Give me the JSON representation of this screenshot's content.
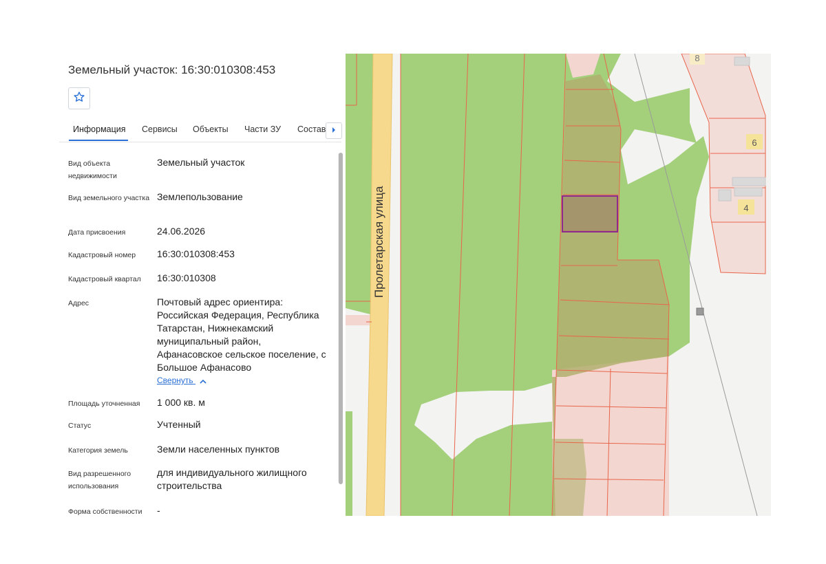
{
  "panel": {
    "title": "Земельный участок: 16:30:010308:453",
    "favorite_icon": "star-icon",
    "tabs": [
      "Информация",
      "Сервисы",
      "Объекты",
      "Части ЗУ",
      "Состав"
    ],
    "active_tab": "Информация",
    "next_icon": "chevron-right-icon",
    "fields": [
      {
        "label": "Вид объекта недвижимости",
        "value": "Земельный участок"
      },
      {
        "label": "Вид земельного участка",
        "value": "Землепользование"
      },
      {
        "label": "Дата присвоения",
        "value": "24.06.2026"
      },
      {
        "label": "Кадастровый номер",
        "value": "16:30:010308:453"
      },
      {
        "label": "Кадастровый квартал",
        "value": "16:30:010308"
      },
      {
        "label": "Адрес",
        "value": "Почтовый адрес ориентира: Российская Федерация, Республика Татарстан, Нижнекамский муниципальный район, Афанасовское сельское поселение, с Большое Афанасово"
      },
      {
        "label": "Площадь уточненная",
        "value": "1 000 кв. м"
      },
      {
        "label": "Статус",
        "value": "Учтенный"
      },
      {
        "label": "Категория земель",
        "value": "Земли населенных пунктов"
      },
      {
        "label": "Вид разрешенного использования",
        "value": "для индивидуального жилищного строительства"
      },
      {
        "label": "Форма собственности",
        "value": "-"
      }
    ],
    "collapse_label": "Свернуть",
    "collapse_icon": "chevron-up-icon"
  },
  "map": {
    "street_label": "Пролетарская улица",
    "house_numbers": [
      "8",
      "6",
      "4"
    ],
    "colors": {
      "background": "#f3f3f2",
      "green": "#a4d07c",
      "pink": "#f3d6d0",
      "parcel_fill": "#b2b070",
      "parcel_line": "#e8654a",
      "selected_outline": "#8e2a8e",
      "road": "#f7d98e",
      "accent": "#2a6fd6"
    }
  }
}
